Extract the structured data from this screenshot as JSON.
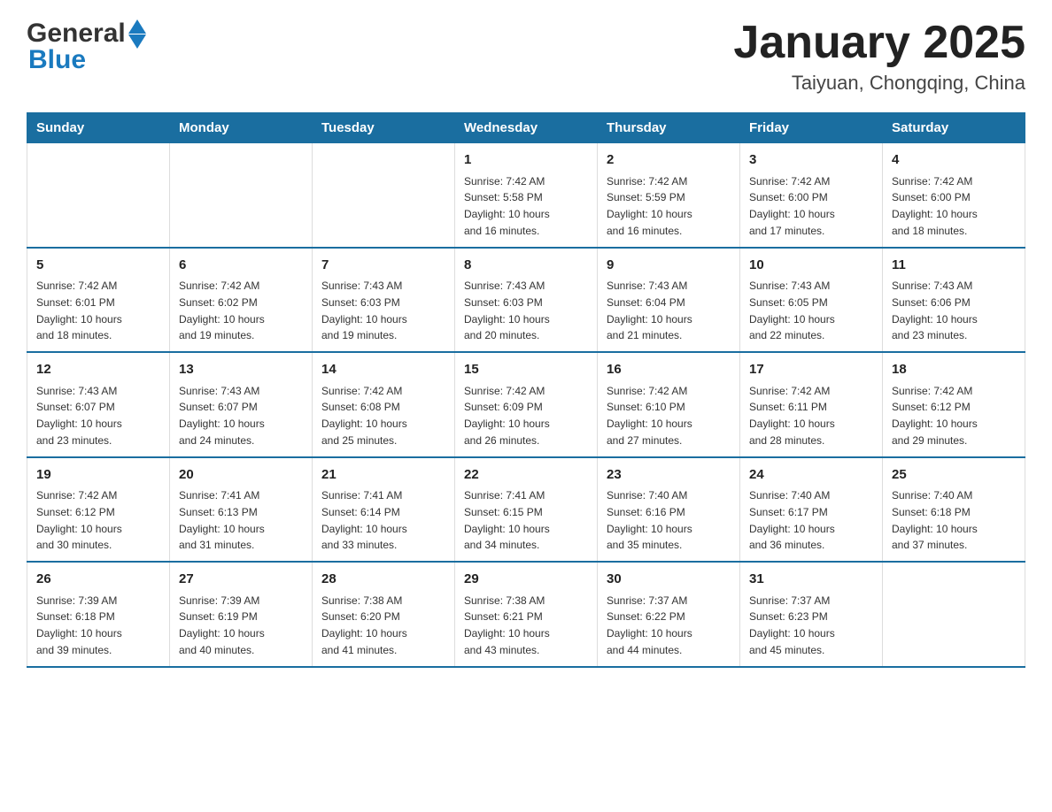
{
  "header": {
    "logo": {
      "general": "General",
      "blue": "Blue",
      "line1": "General",
      "line2": "Blue"
    },
    "title": "January 2025",
    "subtitle": "Taiyuan, Chongqing, China"
  },
  "weekdays": [
    "Sunday",
    "Monday",
    "Tuesday",
    "Wednesday",
    "Thursday",
    "Friday",
    "Saturday"
  ],
  "weeks": [
    [
      {
        "day": "",
        "info": ""
      },
      {
        "day": "",
        "info": ""
      },
      {
        "day": "",
        "info": ""
      },
      {
        "day": "1",
        "info": "Sunrise: 7:42 AM\nSunset: 5:58 PM\nDaylight: 10 hours\nand 16 minutes."
      },
      {
        "day": "2",
        "info": "Sunrise: 7:42 AM\nSunset: 5:59 PM\nDaylight: 10 hours\nand 16 minutes."
      },
      {
        "day": "3",
        "info": "Sunrise: 7:42 AM\nSunset: 6:00 PM\nDaylight: 10 hours\nand 17 minutes."
      },
      {
        "day": "4",
        "info": "Sunrise: 7:42 AM\nSunset: 6:00 PM\nDaylight: 10 hours\nand 18 minutes."
      }
    ],
    [
      {
        "day": "5",
        "info": "Sunrise: 7:42 AM\nSunset: 6:01 PM\nDaylight: 10 hours\nand 18 minutes."
      },
      {
        "day": "6",
        "info": "Sunrise: 7:42 AM\nSunset: 6:02 PM\nDaylight: 10 hours\nand 19 minutes."
      },
      {
        "day": "7",
        "info": "Sunrise: 7:43 AM\nSunset: 6:03 PM\nDaylight: 10 hours\nand 19 minutes."
      },
      {
        "day": "8",
        "info": "Sunrise: 7:43 AM\nSunset: 6:03 PM\nDaylight: 10 hours\nand 20 minutes."
      },
      {
        "day": "9",
        "info": "Sunrise: 7:43 AM\nSunset: 6:04 PM\nDaylight: 10 hours\nand 21 minutes."
      },
      {
        "day": "10",
        "info": "Sunrise: 7:43 AM\nSunset: 6:05 PM\nDaylight: 10 hours\nand 22 minutes."
      },
      {
        "day": "11",
        "info": "Sunrise: 7:43 AM\nSunset: 6:06 PM\nDaylight: 10 hours\nand 23 minutes."
      }
    ],
    [
      {
        "day": "12",
        "info": "Sunrise: 7:43 AM\nSunset: 6:07 PM\nDaylight: 10 hours\nand 23 minutes."
      },
      {
        "day": "13",
        "info": "Sunrise: 7:43 AM\nSunset: 6:07 PM\nDaylight: 10 hours\nand 24 minutes."
      },
      {
        "day": "14",
        "info": "Sunrise: 7:42 AM\nSunset: 6:08 PM\nDaylight: 10 hours\nand 25 minutes."
      },
      {
        "day": "15",
        "info": "Sunrise: 7:42 AM\nSunset: 6:09 PM\nDaylight: 10 hours\nand 26 minutes."
      },
      {
        "day": "16",
        "info": "Sunrise: 7:42 AM\nSunset: 6:10 PM\nDaylight: 10 hours\nand 27 minutes."
      },
      {
        "day": "17",
        "info": "Sunrise: 7:42 AM\nSunset: 6:11 PM\nDaylight: 10 hours\nand 28 minutes."
      },
      {
        "day": "18",
        "info": "Sunrise: 7:42 AM\nSunset: 6:12 PM\nDaylight: 10 hours\nand 29 minutes."
      }
    ],
    [
      {
        "day": "19",
        "info": "Sunrise: 7:42 AM\nSunset: 6:12 PM\nDaylight: 10 hours\nand 30 minutes."
      },
      {
        "day": "20",
        "info": "Sunrise: 7:41 AM\nSunset: 6:13 PM\nDaylight: 10 hours\nand 31 minutes."
      },
      {
        "day": "21",
        "info": "Sunrise: 7:41 AM\nSunset: 6:14 PM\nDaylight: 10 hours\nand 33 minutes."
      },
      {
        "day": "22",
        "info": "Sunrise: 7:41 AM\nSunset: 6:15 PM\nDaylight: 10 hours\nand 34 minutes."
      },
      {
        "day": "23",
        "info": "Sunrise: 7:40 AM\nSunset: 6:16 PM\nDaylight: 10 hours\nand 35 minutes."
      },
      {
        "day": "24",
        "info": "Sunrise: 7:40 AM\nSunset: 6:17 PM\nDaylight: 10 hours\nand 36 minutes."
      },
      {
        "day": "25",
        "info": "Sunrise: 7:40 AM\nSunset: 6:18 PM\nDaylight: 10 hours\nand 37 minutes."
      }
    ],
    [
      {
        "day": "26",
        "info": "Sunrise: 7:39 AM\nSunset: 6:18 PM\nDaylight: 10 hours\nand 39 minutes."
      },
      {
        "day": "27",
        "info": "Sunrise: 7:39 AM\nSunset: 6:19 PM\nDaylight: 10 hours\nand 40 minutes."
      },
      {
        "day": "28",
        "info": "Sunrise: 7:38 AM\nSunset: 6:20 PM\nDaylight: 10 hours\nand 41 minutes."
      },
      {
        "day": "29",
        "info": "Sunrise: 7:38 AM\nSunset: 6:21 PM\nDaylight: 10 hours\nand 43 minutes."
      },
      {
        "day": "30",
        "info": "Sunrise: 7:37 AM\nSunset: 6:22 PM\nDaylight: 10 hours\nand 44 minutes."
      },
      {
        "day": "31",
        "info": "Sunrise: 7:37 AM\nSunset: 6:23 PM\nDaylight: 10 hours\nand 45 minutes."
      },
      {
        "day": "",
        "info": ""
      }
    ]
  ]
}
